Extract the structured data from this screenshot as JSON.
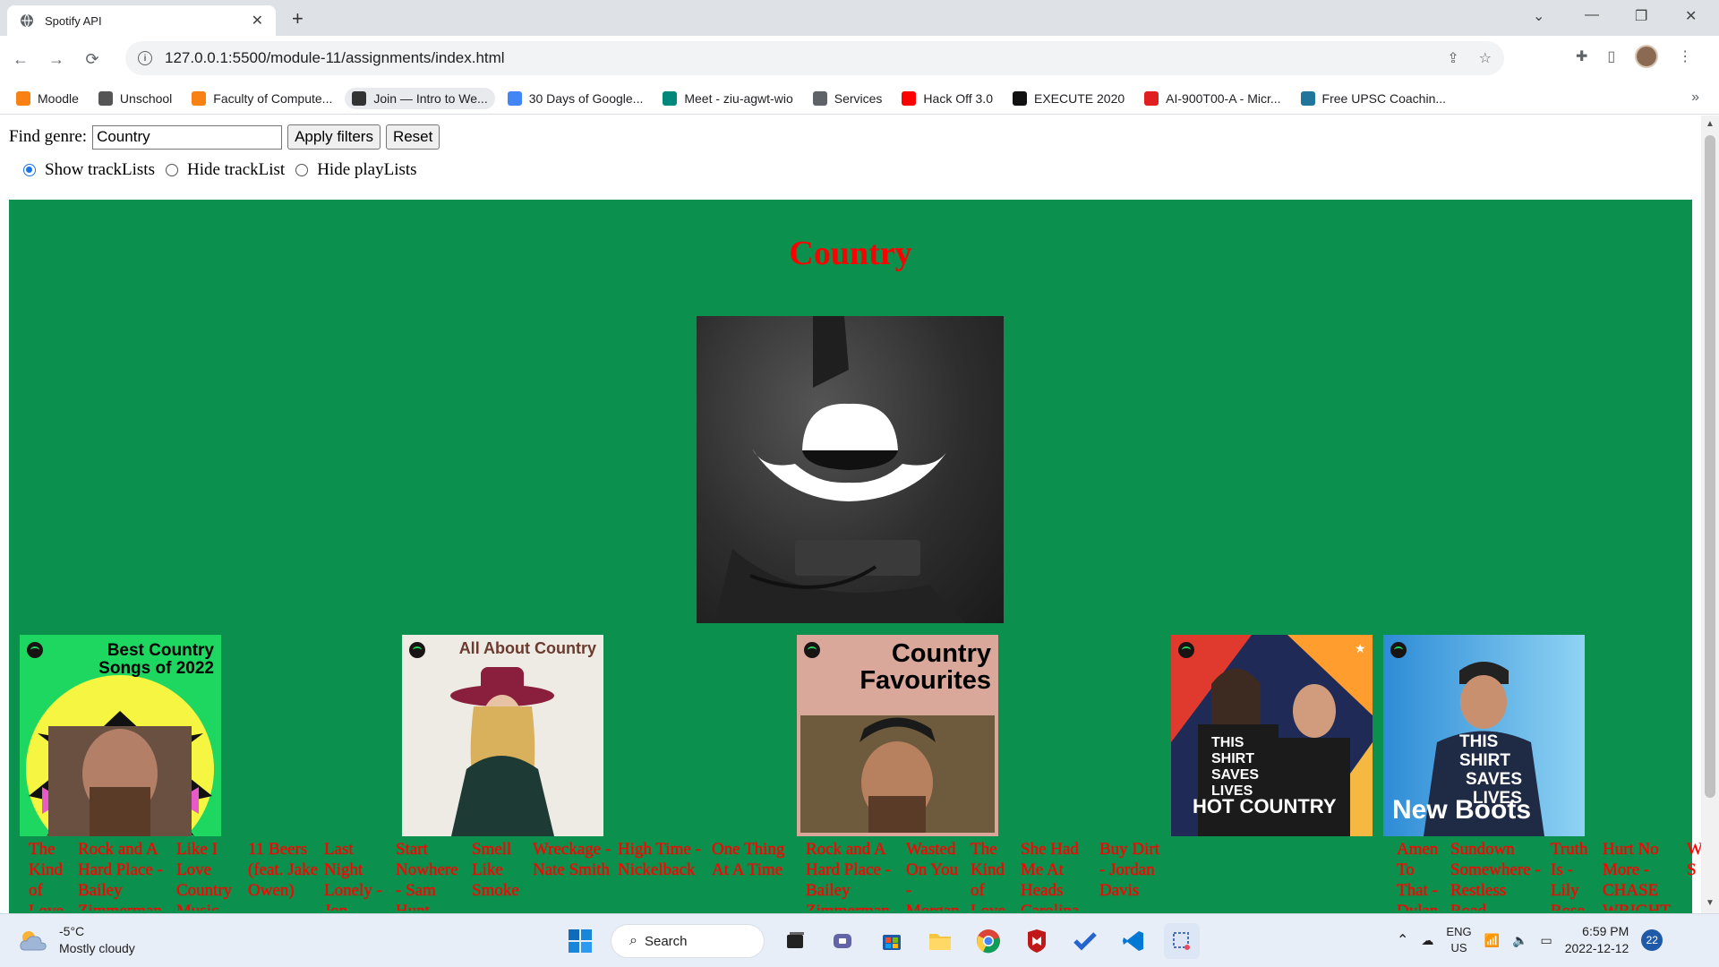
{
  "browser": {
    "tab_title": "Spotify API",
    "url": "127.0.0.1:5500/module-11/assignments/index.html",
    "bookmarks": [
      {
        "label": "Moodle",
        "icon": "moodle-icon",
        "color": "#f98012"
      },
      {
        "label": "Unschool",
        "icon": "apple-icon",
        "color": "#555555"
      },
      {
        "label": "Faculty of Compute...",
        "icon": "moodle-icon",
        "color": "#f98012"
      },
      {
        "label": "Join — Intro to We...",
        "icon": "code-icon",
        "color": "#333333"
      },
      {
        "label": "30 Days of Google...",
        "icon": "google-icon",
        "color": "#4285f4"
      },
      {
        "label": "Meet - ziu-agwt-wio",
        "icon": "meet-icon",
        "color": "#00897b"
      },
      {
        "label": "Services",
        "icon": "globe-icon",
        "color": "#5f6368"
      },
      {
        "label": "Hack Off 3.0",
        "icon": "youtube-icon",
        "color": "#ff0000"
      },
      {
        "label": "EXECUTE 2020",
        "icon": "target-icon",
        "color": "#111111"
      },
      {
        "label": "AI-900T00-A - Micr...",
        "icon": "s-icon",
        "color": "#e02020"
      },
      {
        "label": "Free UPSC Coachin...",
        "icon": "wordpress-icon",
        "color": "#21759b"
      }
    ]
  },
  "filters": {
    "find_label": "Find genre:",
    "genre_value": "Country",
    "apply_label": "Apply filters",
    "reset_label": "Reset",
    "radios": [
      {
        "label": "Show trackLists",
        "checked": true
      },
      {
        "label": "Hide trackList",
        "checked": false
      },
      {
        "label": "Hide playLists",
        "checked": false
      }
    ]
  },
  "genre": {
    "name": "Country",
    "background_color": "#0b914d",
    "title_color": "#ff0000"
  },
  "playlists": [
    {
      "cover_title": "Best Country Songs of 2022",
      "tracks": [
        "The Kind of Love",
        "Rock and A Hard Place - Bailey Zimmerman",
        "Like I Love Country Music",
        "11 Beers (feat. Jake Owen)",
        "Last Night Lonely - Jon",
        "Start Nowhere - Sam Hunt",
        "Smell Like Smoke",
        "Wreckage - Nate Smith",
        "High Time - Nickelback",
        "One Thing At A Time"
      ]
    },
    {
      "cover_title": "All About Country",
      "tracks": []
    },
    {
      "cover_title": "Country Favourites",
      "tracks": [
        "Rock and A Hard Place - Bailey Zimmerman",
        "Wasted On You - Morgan",
        "The Kind of Love",
        "She Had Me At Heads Carolina",
        "Buy Dirt - Jordan Davis"
      ]
    },
    {
      "cover_title": "HOT COUNTRY",
      "cover_caption": "THIS SHIRT SAVES LIVES",
      "tracks": []
    },
    {
      "cover_title": "New Boots",
      "cover_caption": "THIS SHIRT SAVES LIVES",
      "tracks": [
        "Amen To That - Dylan",
        "Sundown Somewhere - Restless Road",
        "Truth Is - Lily Rose",
        "Hurt No More - CHASE WRIGHT",
        "W I S"
      ]
    }
  ],
  "taskbar": {
    "temperature": "-5°C",
    "condition": "Mostly cloudy",
    "search_label": "Search",
    "lang_line1": "ENG",
    "lang_line2": "US",
    "time": "6:59 PM",
    "date": "2022-12-12",
    "notifications": "22"
  }
}
